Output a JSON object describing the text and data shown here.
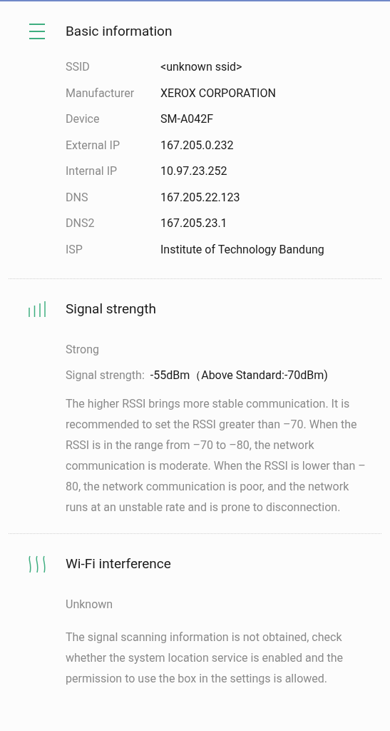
{
  "sections": [
    {
      "kind": "list",
      "title": "Basic information",
      "rows": [
        {
          "label": "SSID",
          "value": "<unknown ssid>"
        },
        {
          "label": "Manufacturer",
          "value": "XEROX CORPORATION"
        },
        {
          "label": "Device",
          "value": "SM-A042F"
        },
        {
          "label": "External IP",
          "value": "167.205.0.232"
        },
        {
          "label": "Internal IP",
          "value": "10.97.23.252"
        },
        {
          "label": "DNS",
          "value": "167.205.22.123"
        },
        {
          "label": "DNS2",
          "value": "167.205.23.1"
        },
        {
          "label": "ISP",
          "value": "Institute of Technology Bandung"
        }
      ]
    },
    {
      "kind": "signal",
      "title": "Signal strength",
      "status": "Strong",
      "reading_label": "Signal strength:",
      "reading_value": "-55dBm（Above Standard:-70dBm)",
      "description": "The higher RSSI brings more stable communication. It is recommended to set the RSSI greater than –70. When the RSSI is in the range from –70 to –80, the network communication is moderate. When the RSSI is lower than –80, the network communication is poor, and the network runs at an unstable rate and is prone to disconnection."
    },
    {
      "kind": "interference",
      "title": "Wi-Fi interference",
      "status": "Unknown",
      "description": "The signal scanning information is not obtained, check whether the system location service is enabled and the permission to use the box in the settings is allowed."
    }
  ]
}
